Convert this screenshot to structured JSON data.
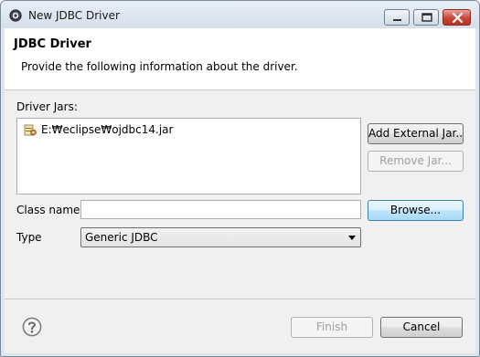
{
  "window": {
    "title": "New JDBC Driver"
  },
  "header": {
    "title": "JDBC Driver",
    "description": "Provide the following information about the driver."
  },
  "driver_jars": {
    "label": "Driver Jars:",
    "items": [
      {
        "path": "E:₩eclipse₩ojdbc14.jar",
        "icon": "jar-file-icon"
      }
    ],
    "add_external_label": "Add External Jar...",
    "remove_label": "Remove Jar..."
  },
  "class_name": {
    "label": "Class name:",
    "value": "",
    "browse_label": "Browse..."
  },
  "type": {
    "label": "Type",
    "selected": "Generic JDBC"
  },
  "footer": {
    "finish_label": "Finish",
    "cancel_label": "Cancel",
    "help_icon": "help-icon"
  }
}
